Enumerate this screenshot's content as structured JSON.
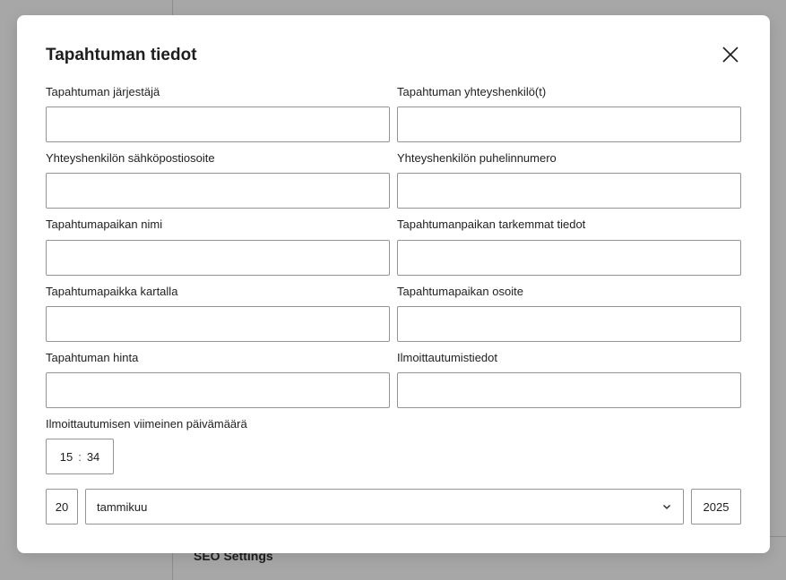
{
  "background": {
    "section_heading": "SEO Settings"
  },
  "modal": {
    "title": "Tapahtuman tiedot",
    "close_icon": "close-icon",
    "fields": {
      "organizer": {
        "label": "Tapahtuman järjestäjä",
        "value": ""
      },
      "contact_person": {
        "label": "Tapahtuman yhteyshenkilö(t)",
        "value": ""
      },
      "contact_email": {
        "label": "Yhteyshenkilön sähköpostiosoite",
        "value": ""
      },
      "contact_phone": {
        "label": "Yhteyshenkilön puhelinnumero",
        "value": ""
      },
      "venue_name": {
        "label": "Tapahtumapaikan nimi",
        "value": ""
      },
      "venue_details": {
        "label": "Tapahtumanpaikan tarkemmat tiedot",
        "value": ""
      },
      "venue_map": {
        "label": "Tapahtumapaikka kartalla",
        "value": ""
      },
      "venue_address": {
        "label": "Tapahtumapaikan osoite",
        "value": ""
      },
      "price": {
        "label": "Tapahtuman hinta",
        "value": ""
      },
      "registration_info": {
        "label": "Ilmoittautumistiedot",
        "value": ""
      }
    },
    "deadline": {
      "label": "Ilmoittautumisen viimeinen päivämäärä",
      "hours": "15",
      "separator": ":",
      "minutes": "34",
      "day": "20",
      "month": "tammikuu",
      "year": "2025",
      "chevron_icon": "chevron-down-icon"
    }
  }
}
